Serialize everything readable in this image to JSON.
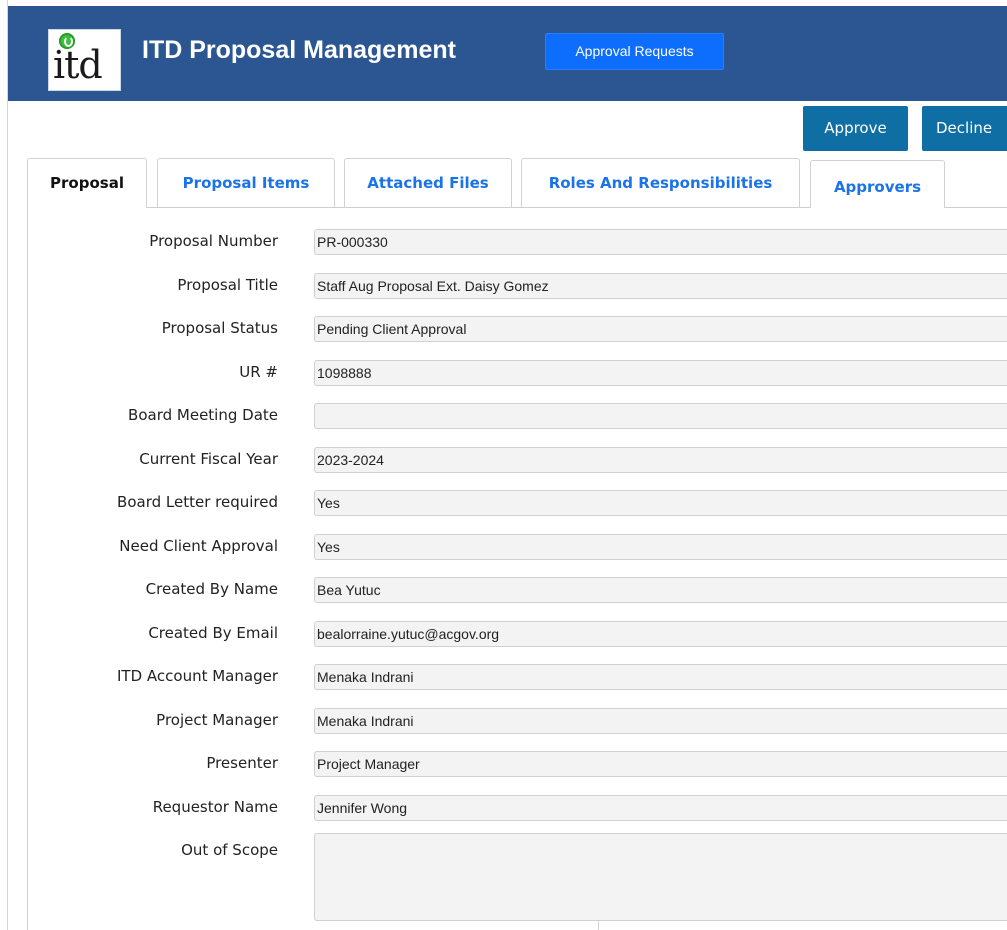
{
  "header": {
    "logo_text": "itd",
    "title": "ITD Proposal Management",
    "approval_requests_label": "Approval Requests"
  },
  "actions": {
    "approve_label": "Approve",
    "decline_label": "Decline"
  },
  "tabs": [
    {
      "label": "Proposal",
      "active": true
    },
    {
      "label": "Proposal Items",
      "active": false
    },
    {
      "label": "Attached Files",
      "active": false
    },
    {
      "label": "Roles And Responsibilities",
      "active": false
    },
    {
      "label": "Approvers",
      "active": false
    }
  ],
  "form": {
    "fields": [
      {
        "label": "Proposal Number",
        "value": "PR-000330"
      },
      {
        "label": "Proposal Title",
        "value": "Staff Aug Proposal Ext. Daisy Gomez"
      },
      {
        "label": "Proposal Status",
        "value": "Pending Client Approval"
      },
      {
        "label": "UR #",
        "value": "1098888"
      },
      {
        "label": "Board Meeting Date",
        "value": ""
      },
      {
        "label": "Current Fiscal Year",
        "value": "2023-2024"
      },
      {
        "label": "Board Letter required",
        "value": "Yes"
      },
      {
        "label": "Need Client Approval",
        "value": "Yes"
      },
      {
        "label": "Created By Name",
        "value": "Bea Yutuc"
      },
      {
        "label": "Created By Email",
        "value": "bealorraine.yutuc@acgov.org"
      },
      {
        "label": "ITD Account Manager",
        "value": "Menaka Indrani"
      },
      {
        "label": "Project Manager",
        "value": "Menaka Indrani"
      },
      {
        "label": "Presenter",
        "value": "Project Manager"
      },
      {
        "label": "Requestor Name",
        "value": "Jennifer Wong"
      }
    ],
    "out_of_scope_label": "Out of Scope",
    "out_of_scope_value": ""
  },
  "colors": {
    "header_bg": "#2b5692",
    "primary_button": "#0d6efd",
    "action_button": "#0f6fa4",
    "tab_link": "#1a73e8"
  },
  "icons": {
    "logo": "itd-logo-icon"
  }
}
